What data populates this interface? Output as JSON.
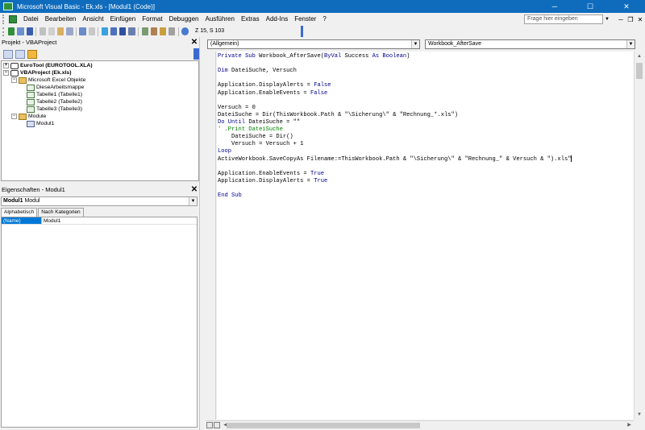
{
  "titlebar": {
    "title": "Microsoft Visual Basic - Ek.xls - [Modul1 (Code)]",
    "minimize": "─",
    "maximize": "☐",
    "close": "✕"
  },
  "menubar": {
    "items": [
      "Datei",
      "Bearbeiten",
      "Ansicht",
      "Einfügen",
      "Format",
      "Debuggen",
      "Ausführen",
      "Extras",
      "Add-Ins",
      "Fenster",
      "?"
    ],
    "help_placeholder": "Frage hier eingeben",
    "mdi_minimize": "─",
    "mdi_restore": "❐",
    "mdi_close": "✕"
  },
  "toolbar": {
    "position": "Z 15, S 103",
    "buttons": [
      "excel-view-icon",
      "insert-module-icon",
      "save-icon",
      "cut-icon",
      "copy-icon",
      "paste-icon",
      "find-icon",
      "undo-icon",
      "redo-icon",
      "run-icon",
      "break-icon",
      "reset-icon",
      "design-mode-icon",
      "project-explorer-icon",
      "properties-icon",
      "object-browser-icon",
      "toolbox-icon",
      "help-icon"
    ]
  },
  "project_panel": {
    "title": "Projekt - VBAProject",
    "close": "✕",
    "tree": [
      {
        "label": "EuroTool (EUROTOOL.XLA)",
        "bold": true,
        "exp": "+"
      },
      {
        "label": "VBAProject (Ek.xls)",
        "bold": true,
        "exp": "−"
      },
      {
        "label": "Microsoft Excel Objekte",
        "bold": false,
        "exp": "−"
      },
      {
        "label": "DieseArbeitsmappe",
        "bold": false
      },
      {
        "label": "Tabelle1 (Tabelle1)",
        "bold": false
      },
      {
        "label": "Tabelle2 (Tabelle2)",
        "bold": false
      },
      {
        "label": "Tabelle3 (Tabelle3)",
        "bold": false
      },
      {
        "label": "Module",
        "bold": false,
        "exp": "−"
      },
      {
        "label": "Modul1",
        "bold": false
      }
    ]
  },
  "properties_panel": {
    "title": "Eigenschaften - Modul1",
    "close": "✕",
    "object_name": "Modul1",
    "object_type": "Modul",
    "tabs": [
      "Alphabetisch",
      "Nach Kategorien"
    ],
    "rows": [
      {
        "name": "(Name)",
        "value": "Modul1"
      }
    ]
  },
  "code_window": {
    "object_combo": "(Allgemein)",
    "procedure_combo": "Workbook_AfterSave",
    "lines": [
      [
        {
          "t": "Private Sub ",
          "k": "kw"
        },
        {
          "t": "Workbook_AfterSave(",
          "k": ""
        },
        {
          "t": "ByVal",
          "k": "kw"
        },
        {
          "t": " Success ",
          "k": ""
        },
        {
          "t": "As Boolean",
          "k": "kw"
        },
        {
          "t": ")",
          "k": ""
        }
      ],
      [],
      [
        {
          "t": "Dim",
          "k": "kw"
        },
        {
          "t": " DateiSuche, Versuch",
          "k": ""
        }
      ],
      [],
      [
        {
          "t": "Application.DisplayAlerts = ",
          "k": ""
        },
        {
          "t": "False",
          "k": "kw"
        }
      ],
      [
        {
          "t": "Application.EnableEvents = ",
          "k": ""
        },
        {
          "t": "False",
          "k": "kw"
        }
      ],
      [],
      [
        {
          "t": "Versuch = 0",
          "k": ""
        }
      ],
      [
        {
          "t": "DateiSuche = Dir(ThisWorkbook.Path & \"\\Sicherung\\\" & \"Rechnung_*.xls\")",
          "k": ""
        }
      ],
      [
        {
          "t": "Do Until",
          "k": "kw"
        },
        {
          "t": " DateiSuche = \"\"",
          "k": ""
        }
      ],
      [
        {
          "t": "' .Print DateiSuche",
          "k": "cm"
        }
      ],
      [
        {
          "t": "    DateiSuche = Dir()",
          "k": ""
        }
      ],
      [
        {
          "t": "    Versuch = Versuch + 1",
          "k": ""
        }
      ],
      [
        {
          "t": "Loop",
          "k": "kw"
        }
      ],
      [
        {
          "t": "ActiveWorkbook.SaveCopyAs Filename:=ThisWorkbook.Path & \"\\Sicherung\\\" & \"Rechnung_\" & Versuch & \").xls\"",
          "k": "",
          "cursor": true
        }
      ],
      [],
      [
        {
          "t": "Application.EnableEvents = ",
          "k": ""
        },
        {
          "t": "True",
          "k": "kw"
        }
      ],
      [
        {
          "t": "Application.DisplayAlerts = ",
          "k": ""
        },
        {
          "t": "True",
          "k": "kw"
        }
      ],
      [],
      [
        {
          "t": "End Sub",
          "k": "kw"
        }
      ]
    ]
  }
}
